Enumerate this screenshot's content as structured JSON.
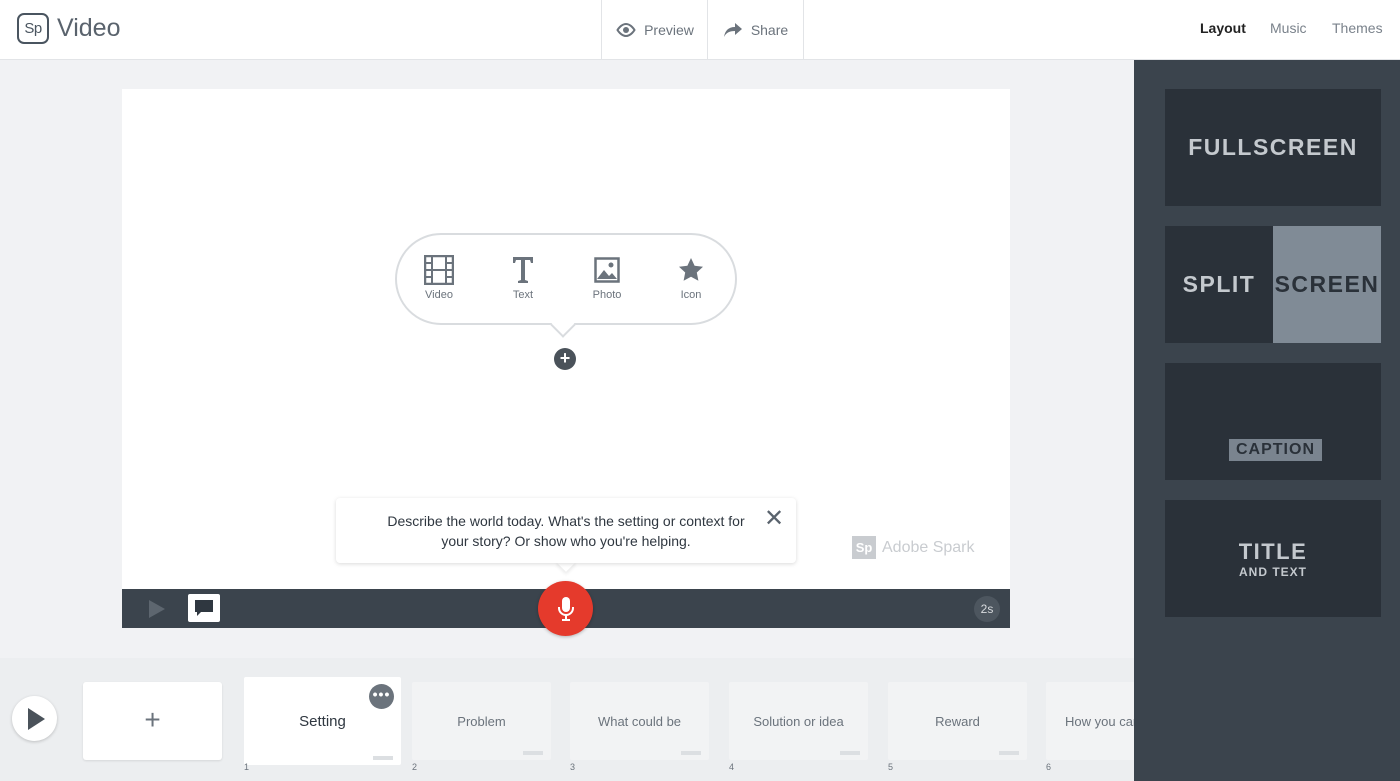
{
  "header": {
    "logo_text": "Sp",
    "title": "Video",
    "preview_label": "Preview",
    "share_label": "Share",
    "tabs": [
      {
        "label": "Layout",
        "active": true
      },
      {
        "label": "Music",
        "active": false
      },
      {
        "label": "Themes",
        "active": false
      }
    ]
  },
  "stage": {
    "media_options": [
      {
        "label": "Video",
        "icon": "film-icon"
      },
      {
        "label": "Text",
        "icon": "text-icon"
      },
      {
        "label": "Photo",
        "icon": "photo-icon"
      },
      {
        "label": "Icon",
        "icon": "star-icon"
      }
    ],
    "add_symbol": "+",
    "hint_text": "Describe the world today. What's the setting or context for your story? Or show who you're helping.",
    "close_symbol": "✕",
    "watermark_logo": "Sp",
    "watermark_text": "Adobe Spark",
    "duration": "2s"
  },
  "layouts": {
    "fullscreen": "FULLSCREEN",
    "split_left": "SPLIT",
    "split_right": "SCREEN",
    "caption": "CAPTION",
    "title_line1": "TITLE",
    "title_line2": "AND TEXT"
  },
  "filmstrip": {
    "add_symbol": "+",
    "more_symbol": "•••",
    "slides": [
      {
        "label": "Setting",
        "number": "1"
      },
      {
        "label": "Problem",
        "number": "2"
      },
      {
        "label": "What could be",
        "number": "3"
      },
      {
        "label": "Solution or idea",
        "number": "4"
      },
      {
        "label": "Reward",
        "number": "5"
      },
      {
        "label": "How you can",
        "number": "6"
      }
    ]
  },
  "colors": {
    "accent_red": "#e53a2c",
    "panel_dark": "#3b444d",
    "card_dark": "#2a3139"
  }
}
